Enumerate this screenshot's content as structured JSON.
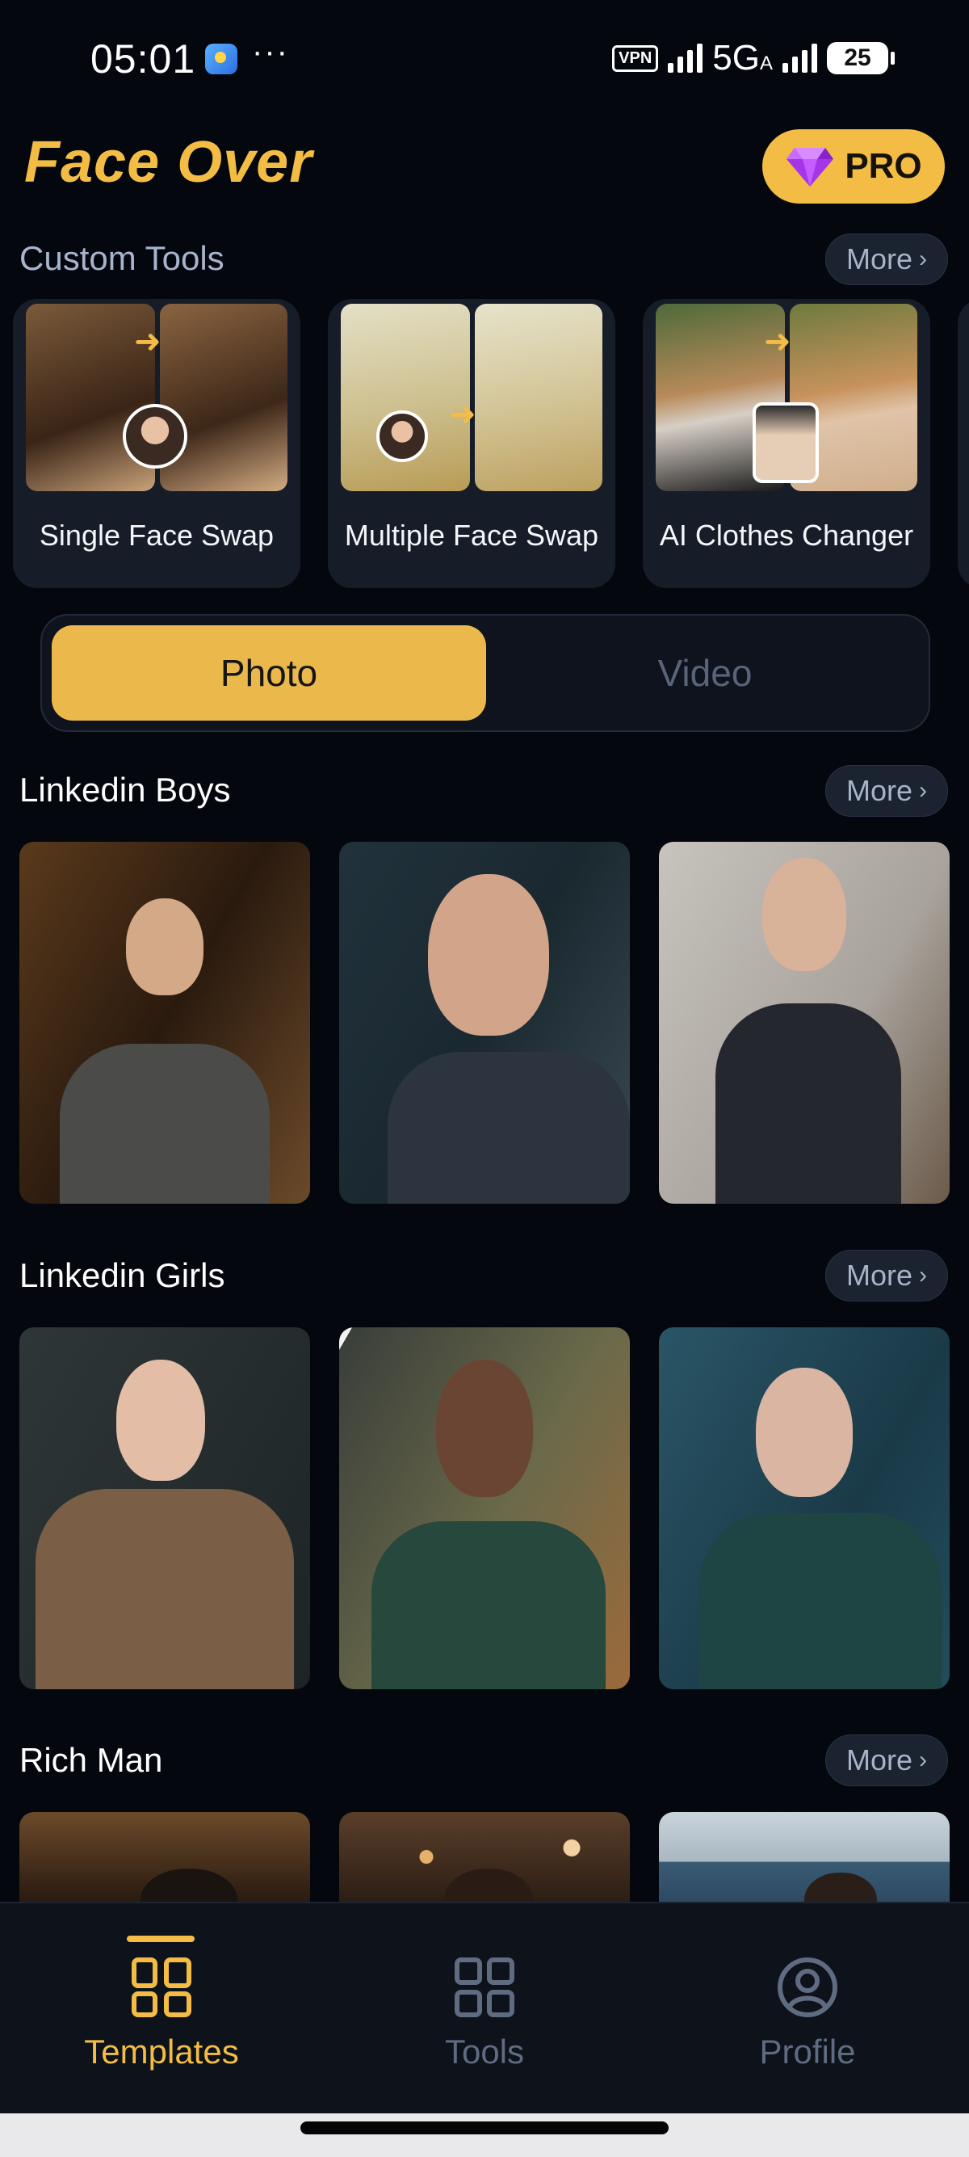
{
  "status_bar": {
    "time": "05:01",
    "more": "···",
    "vpn": "VPN",
    "network": "5G",
    "network_sub": "A",
    "battery": "25"
  },
  "header": {
    "title": "Face Over",
    "pro_label": "PRO"
  },
  "custom_tools": {
    "title": "Custom Tools",
    "more_label": "More",
    "items": [
      {
        "label": "Single Face Swap"
      },
      {
        "label": "Multiple Face Swap"
      },
      {
        "label": "AI Clothes Changer"
      }
    ]
  },
  "media_toggle": {
    "options": [
      "Photo",
      "Video"
    ],
    "selected": "Photo"
  },
  "sections": [
    {
      "title": "Linkedin Boys",
      "more_label": "More"
    },
    {
      "title": "Linkedin Girls",
      "more_label": "More"
    },
    {
      "title": "Rich Man",
      "more_label": "More"
    }
  ],
  "bottom_nav": {
    "items": [
      {
        "label": "Templates",
        "icon": "grid-icon",
        "active": true
      },
      {
        "label": "Tools",
        "icon": "tools-grid-icon",
        "active": false
      },
      {
        "label": "Profile",
        "icon": "profile-icon",
        "active": false
      }
    ]
  },
  "colors": {
    "accent": "#f3bd45",
    "background": "#05070e",
    "card": "#161c28",
    "inactive": "#5f6b80"
  }
}
